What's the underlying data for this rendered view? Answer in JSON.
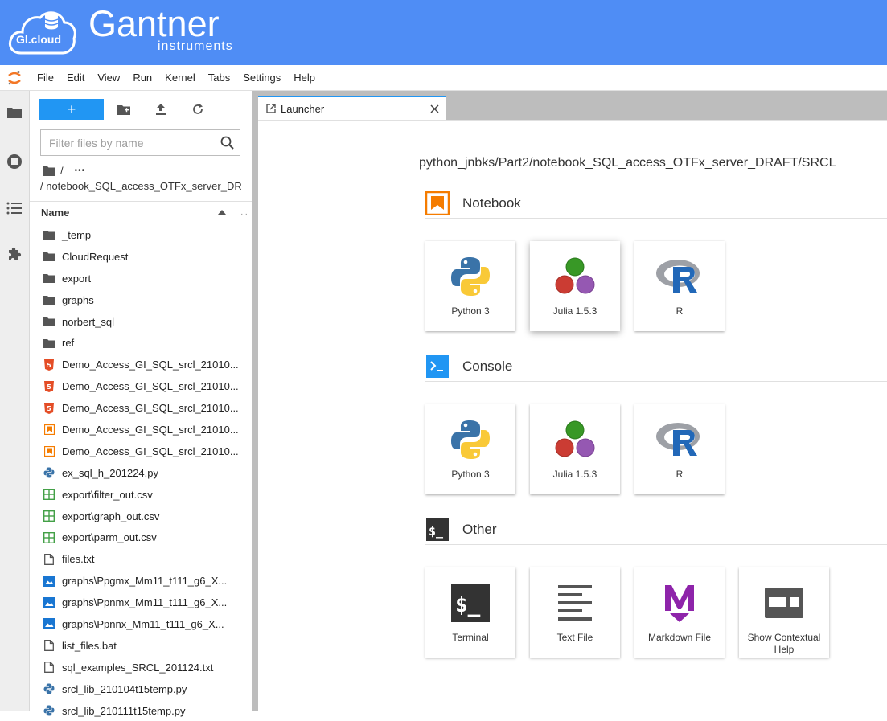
{
  "header": {
    "cloud_label": "Gl.cloud",
    "brand": "Gantner",
    "brand_sub": "instruments"
  },
  "menu": [
    "File",
    "Edit",
    "View",
    "Run",
    "Kernel",
    "Tabs",
    "Settings",
    "Help"
  ],
  "filebrowser": {
    "new_label": "+",
    "filter_placeholder": "Filter files by name",
    "crumb_root": "/",
    "crumb_more": "•••",
    "crumb_path": "/ notebook_SQL_access_OTFx_server_DRAFT",
    "column_name": "Name",
    "column_more": "...",
    "files": [
      {
        "name": "_temp",
        "type": "folder"
      },
      {
        "name": "CloudRequest",
        "type": "folder"
      },
      {
        "name": "export",
        "type": "folder"
      },
      {
        "name": "graphs",
        "type": "folder"
      },
      {
        "name": "norbert_sql",
        "type": "folder"
      },
      {
        "name": "ref",
        "type": "folder"
      },
      {
        "name": "Demo_Access_GI_SQL_srcl_21010...",
        "type": "html"
      },
      {
        "name": "Demo_Access_GI_SQL_srcl_21010...",
        "type": "html"
      },
      {
        "name": "Demo_Access_GI_SQL_srcl_21010...",
        "type": "html"
      },
      {
        "name": "Demo_Access_GI_SQL_srcl_21010...",
        "type": "notebook"
      },
      {
        "name": "Demo_Access_GI_SQL_srcl_21010...",
        "type": "notebook"
      },
      {
        "name": "ex_sql_h_201224.py",
        "type": "python"
      },
      {
        "name": "export\\filter_out.csv",
        "type": "csv"
      },
      {
        "name": "export\\graph_out.csv",
        "type": "csv"
      },
      {
        "name": "export\\parm_out.csv",
        "type": "csv"
      },
      {
        "name": "files.txt",
        "type": "text"
      },
      {
        "name": "graphs\\Ppgmx_Mm11_t111_g6_X...",
        "type": "image"
      },
      {
        "name": "graphs\\Ppnmx_Mm11_t111_g6_X...",
        "type": "image"
      },
      {
        "name": "graphs\\Ppnnx_Mm11_t111_g6_X...",
        "type": "image"
      },
      {
        "name": "list_files.bat",
        "type": "text"
      },
      {
        "name": "sql_examples_SRCL_201124.txt",
        "type": "text"
      },
      {
        "name": "srcl_lib_210104t15temp.py",
        "type": "python"
      },
      {
        "name": "srcl_lib_210111t15temp.py",
        "type": "python"
      }
    ]
  },
  "tab": {
    "label": "Launcher"
  },
  "launcher": {
    "path": "python_jnbks/Part2/notebook_SQL_access_OTFx_server_DRAFT/SRCL",
    "sections": {
      "notebook": {
        "title": "Notebook",
        "cards": [
          {
            "label": "Python 3",
            "icon": "python-icon"
          },
          {
            "label": "Julia 1.5.3",
            "icon": "julia-icon"
          },
          {
            "label": "R",
            "icon": "r-icon"
          }
        ]
      },
      "console": {
        "title": "Console",
        "cards": [
          {
            "label": "Python 3",
            "icon": "python-icon"
          },
          {
            "label": "Julia 1.5.3",
            "icon": "julia-icon"
          },
          {
            "label": "R",
            "icon": "r-icon"
          }
        ]
      },
      "other": {
        "title": "Other",
        "cards": [
          {
            "label": "Terminal",
            "icon": "terminal-icon"
          },
          {
            "label": "Text File",
            "icon": "text-file-icon"
          },
          {
            "label": "Markdown File",
            "icon": "markdown-icon"
          },
          {
            "label": "Show Contextual Help",
            "icon": "contextual-help-icon"
          }
        ]
      }
    }
  },
  "colors": {
    "header_bg": "#4f8df5",
    "accent": "#2196f3",
    "notebook_orange": "#f57c00",
    "console_blue": "#2196f3",
    "other_dark": "#333333"
  }
}
